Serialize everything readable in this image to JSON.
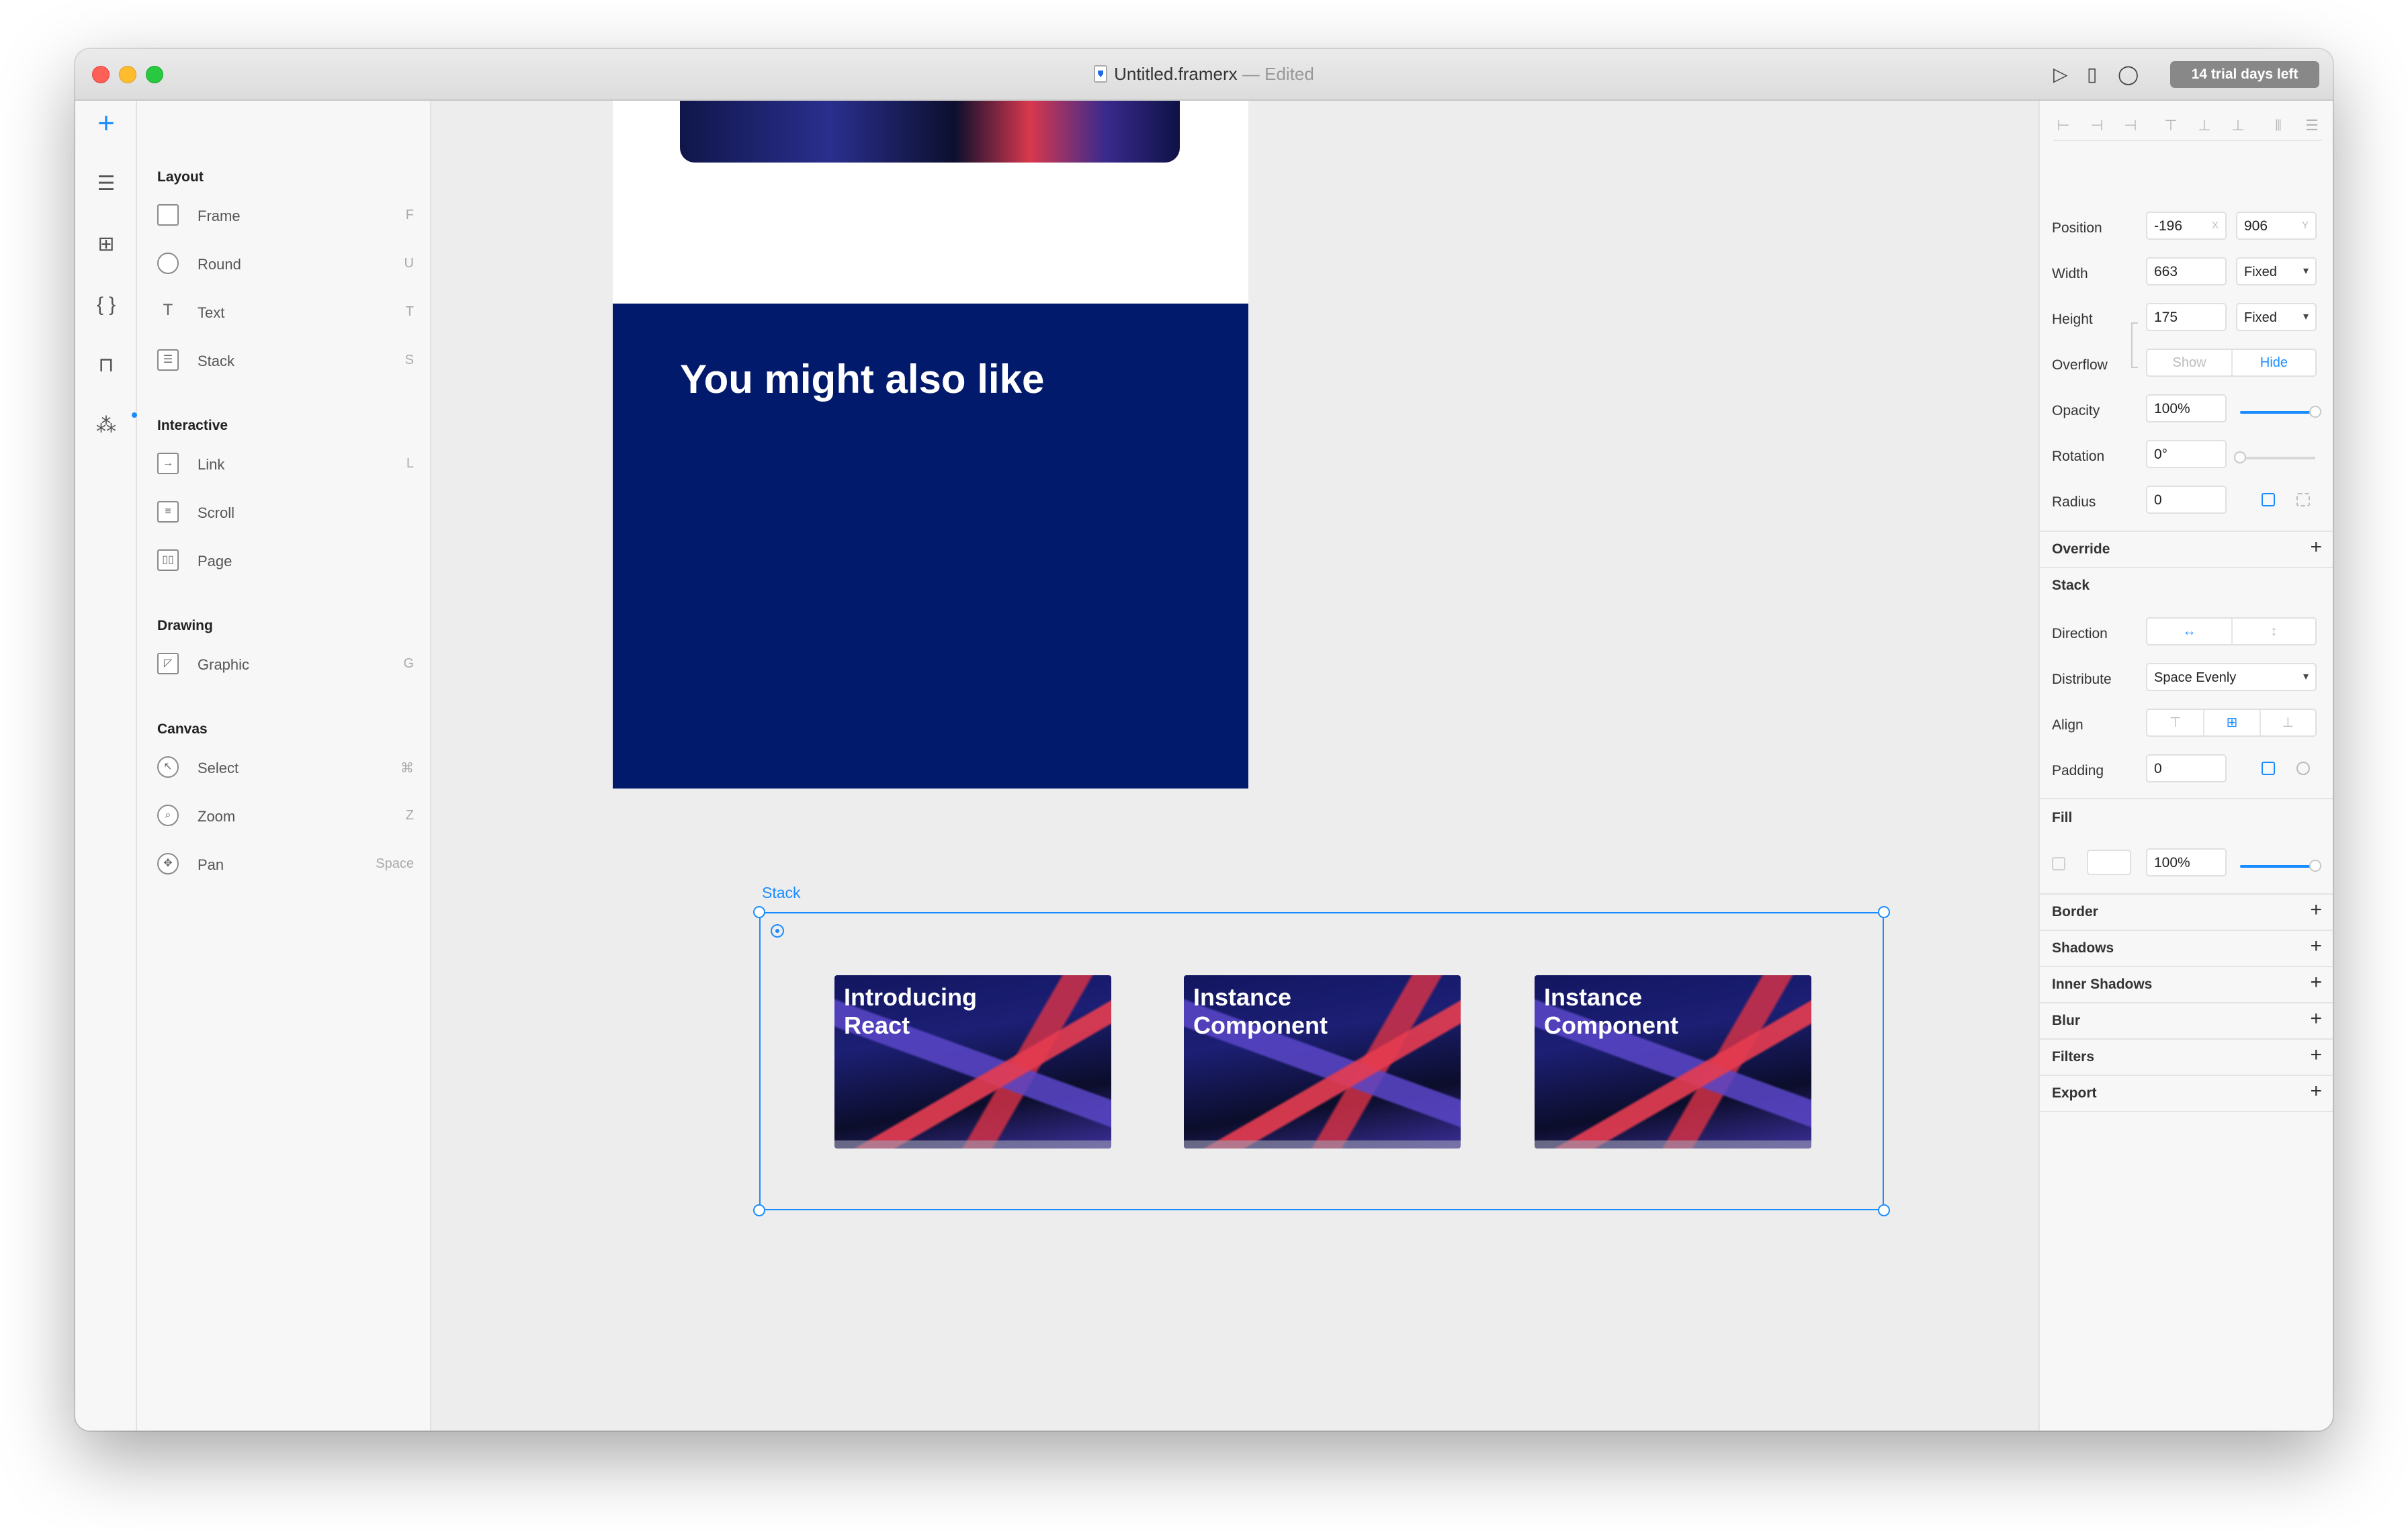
{
  "window": {
    "title": "Untitled.framerx",
    "status": "— Edited",
    "trial_badge": "14 trial days left"
  },
  "toolbar_icons": [
    "play-icon",
    "device-icon",
    "comment-icon"
  ],
  "iconbar": [
    "plus-icon",
    "menu-icon",
    "grid-icon",
    "code-icon",
    "store-icon",
    "components-icon"
  ],
  "insert_panel": {
    "sections": [
      {
        "title": "Layout",
        "items": [
          {
            "label": "Frame",
            "key": "F",
            "icon": "frame-icon"
          },
          {
            "label": "Round",
            "key": "U",
            "icon": "round-icon"
          },
          {
            "label": "Text",
            "key": "T",
            "icon": "text-icon"
          },
          {
            "label": "Stack",
            "key": "S",
            "icon": "stack-icon"
          }
        ]
      },
      {
        "title": "Interactive",
        "items": [
          {
            "label": "Link",
            "key": "L",
            "icon": "link-icon"
          },
          {
            "label": "Scroll",
            "key": "",
            "icon": "scroll-icon"
          },
          {
            "label": "Page",
            "key": "",
            "icon": "page-icon"
          }
        ]
      },
      {
        "title": "Drawing",
        "items": [
          {
            "label": "Graphic",
            "key": "G",
            "icon": "graphic-icon"
          }
        ]
      },
      {
        "title": "Canvas",
        "items": [
          {
            "label": "Select",
            "key": "⌘",
            "icon": "select-icon"
          },
          {
            "label": "Zoom",
            "key": "Z",
            "icon": "zoom-icon"
          },
          {
            "label": "Pan",
            "key": "Space",
            "icon": "pan-icon"
          }
        ]
      }
    ]
  },
  "canvas": {
    "section_heading": "You might also like",
    "stack_label": "Stack",
    "cards": [
      {
        "title_line1": "Introducing",
        "title_line2": "React"
      },
      {
        "title_line1": "Instance",
        "title_line2": "Component"
      },
      {
        "title_line1": "Instance",
        "title_line2": "Component"
      }
    ]
  },
  "properties": {
    "position": {
      "label": "Position",
      "x": "-196",
      "x_suffix": "X",
      "y": "906",
      "y_suffix": "Y"
    },
    "width": {
      "label": "Width",
      "value": "663",
      "mode": "Fixed"
    },
    "height": {
      "label": "Height",
      "value": "175",
      "mode": "Fixed"
    },
    "overflow": {
      "label": "Overflow",
      "show": "Show",
      "hide": "Hide",
      "selected": "Hide"
    },
    "opacity": {
      "label": "Opacity",
      "value": "100%",
      "level": 1.0
    },
    "rotation": {
      "label": "Rotation",
      "value": "0°",
      "level": 0.0
    },
    "radius": {
      "label": "Radius",
      "value": "0"
    },
    "override": {
      "label": "Override"
    },
    "stack": {
      "title": "Stack",
      "direction_label": "Direction",
      "direction_horizontal": "↔",
      "direction_vertical": "↕",
      "distribute_label": "Distribute",
      "distribute_value": "Space Evenly",
      "align_label": "Align",
      "padding_label": "Padding",
      "padding_value": "0"
    },
    "fill": {
      "label": "Fill",
      "opacity": "100%",
      "level": 1.0
    },
    "sections": [
      "Border",
      "Shadows",
      "Inner Shadows",
      "Blur",
      "Filters",
      "Export"
    ]
  },
  "colors": {
    "accent": "#1a8cff",
    "frame_blue": "#021a6b",
    "trial_badge": "#888888"
  }
}
